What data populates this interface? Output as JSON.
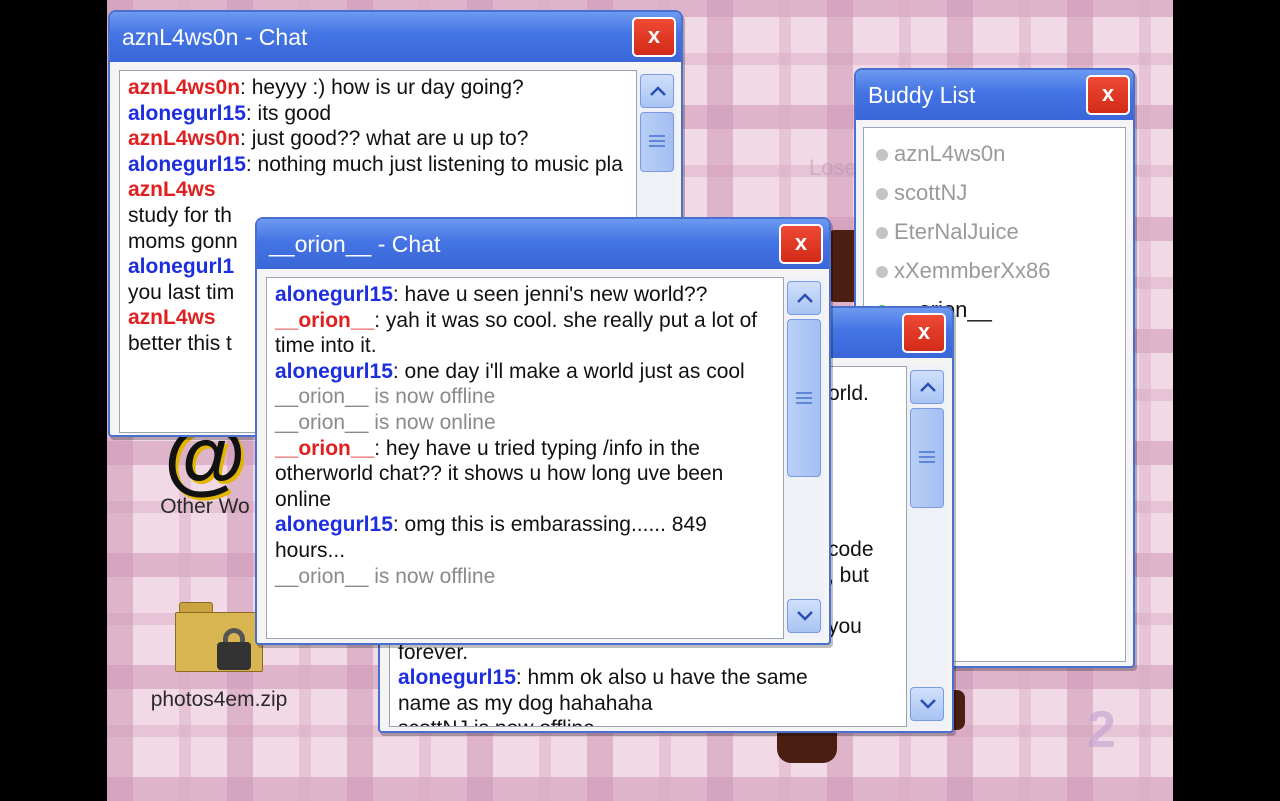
{
  "desktop": {
    "icons": [
      {
        "label": "Other Wo"
      },
      {
        "label": "photos4em.zip"
      }
    ],
    "background_text": "LoseAmp R"
  },
  "chat1": {
    "title": "aznL4ws0n - Chat",
    "close_label": "x",
    "messages": [
      {
        "user": "aznL4ws0n",
        "text": ": heyyy :) how is ur day going?"
      },
      {
        "user": "alonegurl15",
        "text": ": its good"
      },
      {
        "user": "aznL4ws0n",
        "text": ": just good?? what are u up to?"
      },
      {
        "user": "alonegurl15",
        "text": ": nothing much just listening to music pla"
      },
      {
        "user": "aznL4ws",
        "text": " study for th"
      },
      {
        "user": "",
        "text": "moms gonn"
      },
      {
        "user": "alonegurl1",
        "text": " you last tim"
      },
      {
        "user": "aznL4ws",
        "text": " better this t"
      }
    ]
  },
  "chat3": {
    "title": "",
    "close_label": "x",
    "fragments": [
      "orld.",
      "code",
      ", but",
      "you",
      "forever."
    ],
    "messages": [
      {
        "user": "alonegurl15",
        "text": ": hmm ok also u have the same name as my dog hahahaha"
      },
      {
        "user": "",
        "text": "scottNJ is now offline"
      }
    ]
  },
  "chat2": {
    "title": "__orion__ - Chat",
    "close_label": "x",
    "messages": [
      {
        "user": "alonegurl15",
        "text": ": have u seen jenni's new world??",
        "system": false
      },
      {
        "user": "__orion__",
        "text": ": yah it was so cool. she really put a lot of time into it.",
        "system": false
      },
      {
        "user": "alonegurl15",
        "text": ": one day i'll make a world just as cool",
        "system": false
      },
      {
        "user": "",
        "text": "__orion__ is now offline",
        "system": true
      },
      {
        "user": "",
        "text": "__orion__ is now online",
        "system": true
      },
      {
        "user": "__orion__",
        "text": ": hey have u tried typing /info in the otherworld chat?? it shows u how long uve been online",
        "system": false
      },
      {
        "user": "alonegurl15",
        "text": ": omg this is embarassing...... 849 hours...",
        "system": false
      },
      {
        "user": "",
        "text": "__orion__ is now offline",
        "system": true
      }
    ]
  },
  "buddy_list": {
    "title": "Buddy List",
    "close_label": "x",
    "buddies": [
      {
        "name": "aznL4ws0n",
        "status": "offline"
      },
      {
        "name": "scottNJ",
        "status": "offline"
      },
      {
        "name": "EterNalJuice",
        "status": "offline"
      },
      {
        "name": "xXemmberXx86",
        "status": "offline"
      },
      {
        "name": "__orion__",
        "status": "online"
      }
    ]
  },
  "colors": {
    "self_user": "#1d2ee0",
    "other_user": "#e02020",
    "system_text": "#8a8a8a",
    "titlebar": "#4474e4",
    "close_button": "#e03a26",
    "online_dot": "#3ccc3c"
  }
}
